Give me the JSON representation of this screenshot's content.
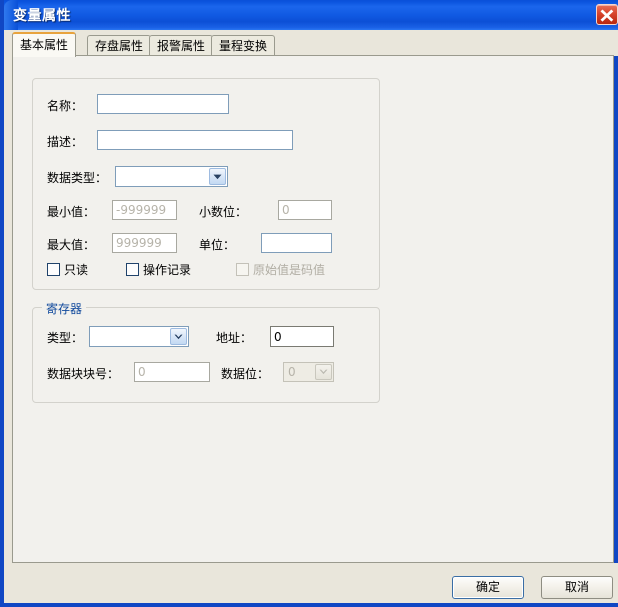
{
  "window": {
    "title": "变量属性",
    "close_icon": "close-x-icon",
    "accent_color": "#1047c4",
    "content_bg": "#f2f1ed",
    "footer_bg": "#e9e6db"
  },
  "tabs": [
    {
      "label": "基本属性",
      "active": true
    },
    {
      "label": "存盘属性",
      "active": false
    },
    {
      "label": "报警属性",
      "active": false
    },
    {
      "label": "量程变换",
      "active": false
    }
  ],
  "basic_group": {
    "legend": "",
    "fields": {
      "name": {
        "label": "名称：",
        "value": "",
        "enabled": true
      },
      "description": {
        "label": "描述：",
        "value": "",
        "enabled": true
      },
      "data_type": {
        "label": "数据类型：",
        "value": "",
        "enabled": true,
        "dropdown_icon": "chevron-down-icon"
      },
      "min_value": {
        "label": "最小值：",
        "value": "-999999",
        "enabled": false
      },
      "decimal_places": {
        "label": "小数位：",
        "value": "0",
        "enabled": false
      },
      "max_value": {
        "label": "最大值：",
        "value": "999999",
        "enabled": false
      },
      "unit": {
        "label": "单位：",
        "value": "",
        "enabled": true
      }
    },
    "checkboxes": [
      {
        "label": "只读",
        "checked": false,
        "enabled": true
      },
      {
        "label": "操作记录",
        "checked": false,
        "enabled": true
      },
      {
        "label": "原始值是码值",
        "checked": false,
        "enabled": false
      }
    ]
  },
  "register_group": {
    "legend": "寄存器",
    "legend_color": "#10499c",
    "fields": {
      "type": {
        "label": "类型：",
        "value": "",
        "enabled": true,
        "dropdown_icon": "chevron-down-icon"
      },
      "address": {
        "label": "地址：",
        "value": "0",
        "enabled": true
      },
      "block_number": {
        "label": "数据块块号：",
        "value": "0",
        "enabled": false
      },
      "data_bit": {
        "label": "数据位：",
        "value": "0",
        "enabled": false,
        "dropdown_icon": "chevron-down-icon"
      }
    }
  },
  "footer": {
    "ok_label": "确定",
    "cancel_label": "取消"
  }
}
